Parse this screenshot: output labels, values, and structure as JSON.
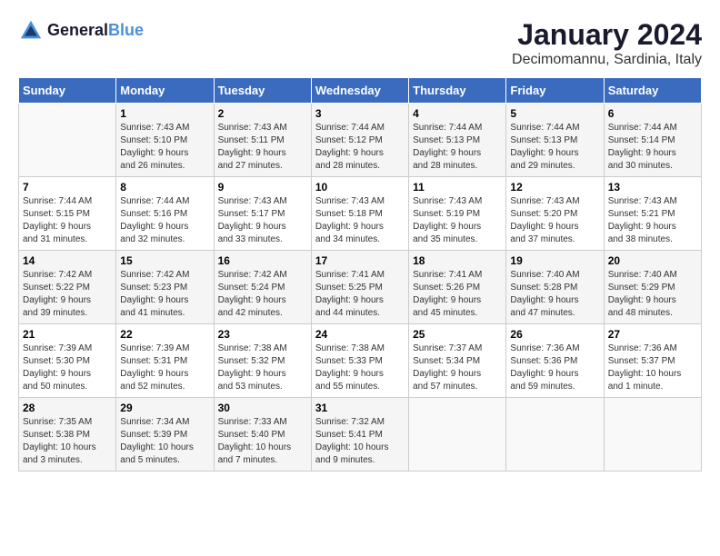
{
  "logo": {
    "line1": "General",
    "line2": "Blue"
  },
  "title": "January 2024",
  "location": "Decimomannu, Sardinia, Italy",
  "weekdays": [
    "Sunday",
    "Monday",
    "Tuesday",
    "Wednesday",
    "Thursday",
    "Friday",
    "Saturday"
  ],
  "weeks": [
    [
      {
        "day": "",
        "info": ""
      },
      {
        "day": "1",
        "info": "Sunrise: 7:43 AM\nSunset: 5:10 PM\nDaylight: 9 hours\nand 26 minutes."
      },
      {
        "day": "2",
        "info": "Sunrise: 7:43 AM\nSunset: 5:11 PM\nDaylight: 9 hours\nand 27 minutes."
      },
      {
        "day": "3",
        "info": "Sunrise: 7:44 AM\nSunset: 5:12 PM\nDaylight: 9 hours\nand 28 minutes."
      },
      {
        "day": "4",
        "info": "Sunrise: 7:44 AM\nSunset: 5:13 PM\nDaylight: 9 hours\nand 28 minutes."
      },
      {
        "day": "5",
        "info": "Sunrise: 7:44 AM\nSunset: 5:13 PM\nDaylight: 9 hours\nand 29 minutes."
      },
      {
        "day": "6",
        "info": "Sunrise: 7:44 AM\nSunset: 5:14 PM\nDaylight: 9 hours\nand 30 minutes."
      }
    ],
    [
      {
        "day": "7",
        "info": "Sunrise: 7:44 AM\nSunset: 5:15 PM\nDaylight: 9 hours\nand 31 minutes."
      },
      {
        "day": "8",
        "info": "Sunrise: 7:44 AM\nSunset: 5:16 PM\nDaylight: 9 hours\nand 32 minutes."
      },
      {
        "day": "9",
        "info": "Sunrise: 7:43 AM\nSunset: 5:17 PM\nDaylight: 9 hours\nand 33 minutes."
      },
      {
        "day": "10",
        "info": "Sunrise: 7:43 AM\nSunset: 5:18 PM\nDaylight: 9 hours\nand 34 minutes."
      },
      {
        "day": "11",
        "info": "Sunrise: 7:43 AM\nSunset: 5:19 PM\nDaylight: 9 hours\nand 35 minutes."
      },
      {
        "day": "12",
        "info": "Sunrise: 7:43 AM\nSunset: 5:20 PM\nDaylight: 9 hours\nand 37 minutes."
      },
      {
        "day": "13",
        "info": "Sunrise: 7:43 AM\nSunset: 5:21 PM\nDaylight: 9 hours\nand 38 minutes."
      }
    ],
    [
      {
        "day": "14",
        "info": "Sunrise: 7:42 AM\nSunset: 5:22 PM\nDaylight: 9 hours\nand 39 minutes."
      },
      {
        "day": "15",
        "info": "Sunrise: 7:42 AM\nSunset: 5:23 PM\nDaylight: 9 hours\nand 41 minutes."
      },
      {
        "day": "16",
        "info": "Sunrise: 7:42 AM\nSunset: 5:24 PM\nDaylight: 9 hours\nand 42 minutes."
      },
      {
        "day": "17",
        "info": "Sunrise: 7:41 AM\nSunset: 5:25 PM\nDaylight: 9 hours\nand 44 minutes."
      },
      {
        "day": "18",
        "info": "Sunrise: 7:41 AM\nSunset: 5:26 PM\nDaylight: 9 hours\nand 45 minutes."
      },
      {
        "day": "19",
        "info": "Sunrise: 7:40 AM\nSunset: 5:28 PM\nDaylight: 9 hours\nand 47 minutes."
      },
      {
        "day": "20",
        "info": "Sunrise: 7:40 AM\nSunset: 5:29 PM\nDaylight: 9 hours\nand 48 minutes."
      }
    ],
    [
      {
        "day": "21",
        "info": "Sunrise: 7:39 AM\nSunset: 5:30 PM\nDaylight: 9 hours\nand 50 minutes."
      },
      {
        "day": "22",
        "info": "Sunrise: 7:39 AM\nSunset: 5:31 PM\nDaylight: 9 hours\nand 52 minutes."
      },
      {
        "day": "23",
        "info": "Sunrise: 7:38 AM\nSunset: 5:32 PM\nDaylight: 9 hours\nand 53 minutes."
      },
      {
        "day": "24",
        "info": "Sunrise: 7:38 AM\nSunset: 5:33 PM\nDaylight: 9 hours\nand 55 minutes."
      },
      {
        "day": "25",
        "info": "Sunrise: 7:37 AM\nSunset: 5:34 PM\nDaylight: 9 hours\nand 57 minutes."
      },
      {
        "day": "26",
        "info": "Sunrise: 7:36 AM\nSunset: 5:36 PM\nDaylight: 9 hours\nand 59 minutes."
      },
      {
        "day": "27",
        "info": "Sunrise: 7:36 AM\nSunset: 5:37 PM\nDaylight: 10 hours\nand 1 minute."
      }
    ],
    [
      {
        "day": "28",
        "info": "Sunrise: 7:35 AM\nSunset: 5:38 PM\nDaylight: 10 hours\nand 3 minutes."
      },
      {
        "day": "29",
        "info": "Sunrise: 7:34 AM\nSunset: 5:39 PM\nDaylight: 10 hours\nand 5 minutes."
      },
      {
        "day": "30",
        "info": "Sunrise: 7:33 AM\nSunset: 5:40 PM\nDaylight: 10 hours\nand 7 minutes."
      },
      {
        "day": "31",
        "info": "Sunrise: 7:32 AM\nSunset: 5:41 PM\nDaylight: 10 hours\nand 9 minutes."
      },
      {
        "day": "",
        "info": ""
      },
      {
        "day": "",
        "info": ""
      },
      {
        "day": "",
        "info": ""
      }
    ]
  ]
}
